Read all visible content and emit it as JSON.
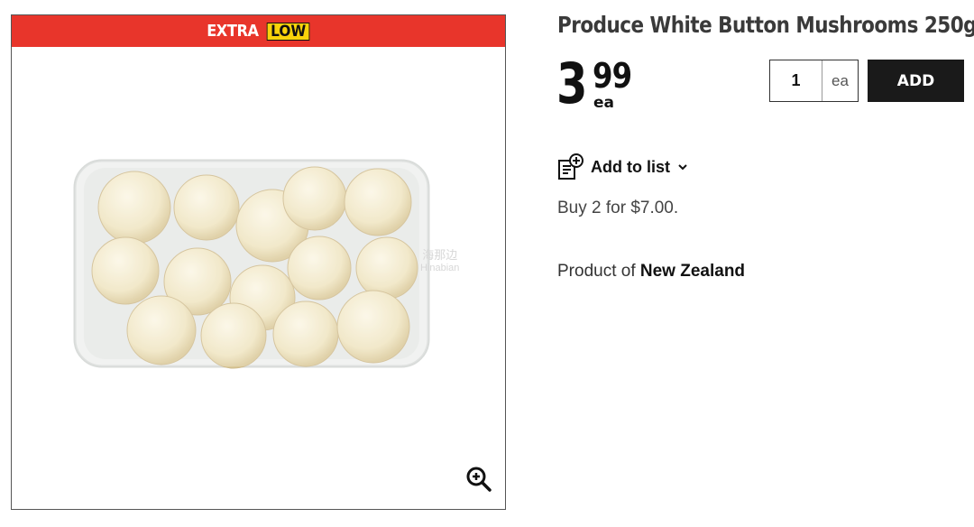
{
  "badge": {
    "extra": "EXTRA",
    "low": "LOW"
  },
  "product": {
    "title": "Produce White Button Mushrooms 250g",
    "price_dollars": "3",
    "price_cents": "99",
    "price_unit": "ea",
    "image_description": "package of white button mushrooms",
    "origin_prefix": "Product of",
    "origin_country": "New Zealand"
  },
  "quantity": {
    "value": "1",
    "unit": "ea"
  },
  "actions": {
    "add_label": "ADD",
    "add_to_list_label": "Add to list"
  },
  "promo": {
    "text": "Buy 2 for $7.00."
  },
  "watermark": {
    "line1": "海那边",
    "line2": "Hinabian"
  },
  "icons": {
    "zoom": "zoom-in-icon",
    "list": "list-add-icon",
    "chevron": "chevron-down-icon"
  },
  "colors": {
    "badge_red": "#e8352b",
    "badge_yellow": "#f9d30a",
    "button_dark": "#1a1a1a"
  }
}
